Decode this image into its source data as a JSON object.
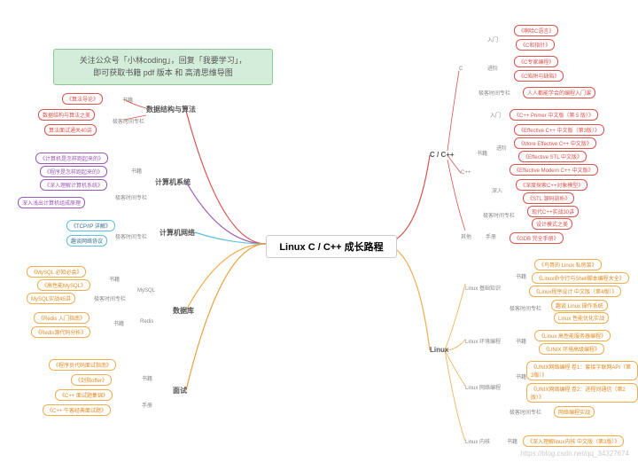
{
  "banner": {
    "line1": "关注公众号「小林coding」，回复「我要学习」，",
    "line2": "即可获取书籍 pdf 版本 和 高清思维导图"
  },
  "center": "Linux C / C++ 成长路程",
  "left": {
    "ds": {
      "title": "数据结构与算法",
      "sub1": "书籍",
      "b1": "《算法导论》",
      "b2": "数据结构与算法之美",
      "sub2": "极客时间专栏",
      "b3": "算法面试通关40讲"
    },
    "sys": {
      "title": "计算机系统",
      "sub1": "书籍",
      "b1": "《计算机是怎样跑起来的》",
      "b2": "《程序是怎样跑起来的》",
      "b3": "《深入理解计算机系统》",
      "sub2": "极客时间专栏",
      "b4": "深入浅出计算机组成原理"
    },
    "net": {
      "title": "计算机网络",
      "sub": "极客时间专栏",
      "b1": "《TCP/IP 详解》",
      "b2": "趣谈网络协议"
    },
    "db": {
      "title": "数据库",
      "m": "MySQL",
      "ms1": "书籍",
      "mb1": "《MySQL 必知必会》",
      "mb2": "《高性能MySQL》",
      "ms2": "极客时间专栏",
      "mb3": "MySQL实战45讲",
      "r": "Redis",
      "rs": "书籍",
      "rb1": "《Redis 入门指南》",
      "rb2": "《Redis源代码分析》"
    },
    "iv": {
      "title": "面试",
      "s1": "书籍",
      "b1": "《程序员代码面试指南》",
      "b2": "《剑指offer》",
      "b3": "《C++ 面试题集锦》",
      "s2": "手册",
      "b4": "《C++ 牛客经典面试题》"
    }
  },
  "right": {
    "cc": {
      "title": "C / C++",
      "c": {
        "title": "C",
        "e1": "入门",
        "eb1": "《啊哈C语言》",
        "eb2": "《C和指针》",
        "e2": "进阶",
        "eb3": "《C专家编程》",
        "eb4": "《C陷阱与缺陷》",
        "e3": "极客时间专栏",
        "eb5": "人人都能学会的编程入门课"
      },
      "cpp": {
        "title": "C++",
        "e1": "入门",
        "eb1": "《C++ Primer 中文版（第 5 版）》",
        "e2": "书籍",
        "e3": "进阶",
        "eb2": "《Effective C++ 中文版（第3版）》",
        "eb3": "《More Effective C++ 中文版》",
        "eb4": "《Effective STL 中文版》",
        "eb5": "《Effective Modern C++ 中文版》",
        "e4": "深入",
        "eb6": "《深度探索C++对象模型》",
        "eb7": "《STL 源码剖析》",
        "e5": "极客时间专栏",
        "eb8": "现代C++实战30讲",
        "eb9": "设计模式之美"
      },
      "o": {
        "title": "其他",
        "s": "手册",
        "b": "《GDB 完全手册》"
      }
    },
    "lx": {
      "title": "Linux",
      "base": {
        "title": "Linux 基础知识",
        "s1": "书籍",
        "b1": "《鸟哥的 Linux 私房菜》",
        "b2": "《Linux命令行与Shell脚本编程大全》",
        "b3": "《Linux程序设计 中文版（第4版）》",
        "s2": "极客时间专栏",
        "b4": "趣谈 Linux 操作系统",
        "b5": "Linux 性能优化实战"
      },
      "env": {
        "title": "Linux 环境编程",
        "s": "书籍",
        "b1": "《Linux 高性能服务器编程》",
        "b2": "《UNIX 环境高级编程》"
      },
      "netp": {
        "title": "Linux 网络编程",
        "s1": "书籍",
        "b1": "《UNIX网络编程 卷1：套接字联网API（第3版）》",
        "b2": "《UNIX网络编程 卷2：进程间通信（第2版）》",
        "s2": "极客时间专栏",
        "b3": "网络编程实战"
      },
      "kernel": {
        "title": "Linux 内核",
        "s": "书籍",
        "b": "《深入理解linux内核 中文版（第3版）》"
      }
    }
  },
  "watermark": "https://blog.csdn.net/qq_34327674"
}
